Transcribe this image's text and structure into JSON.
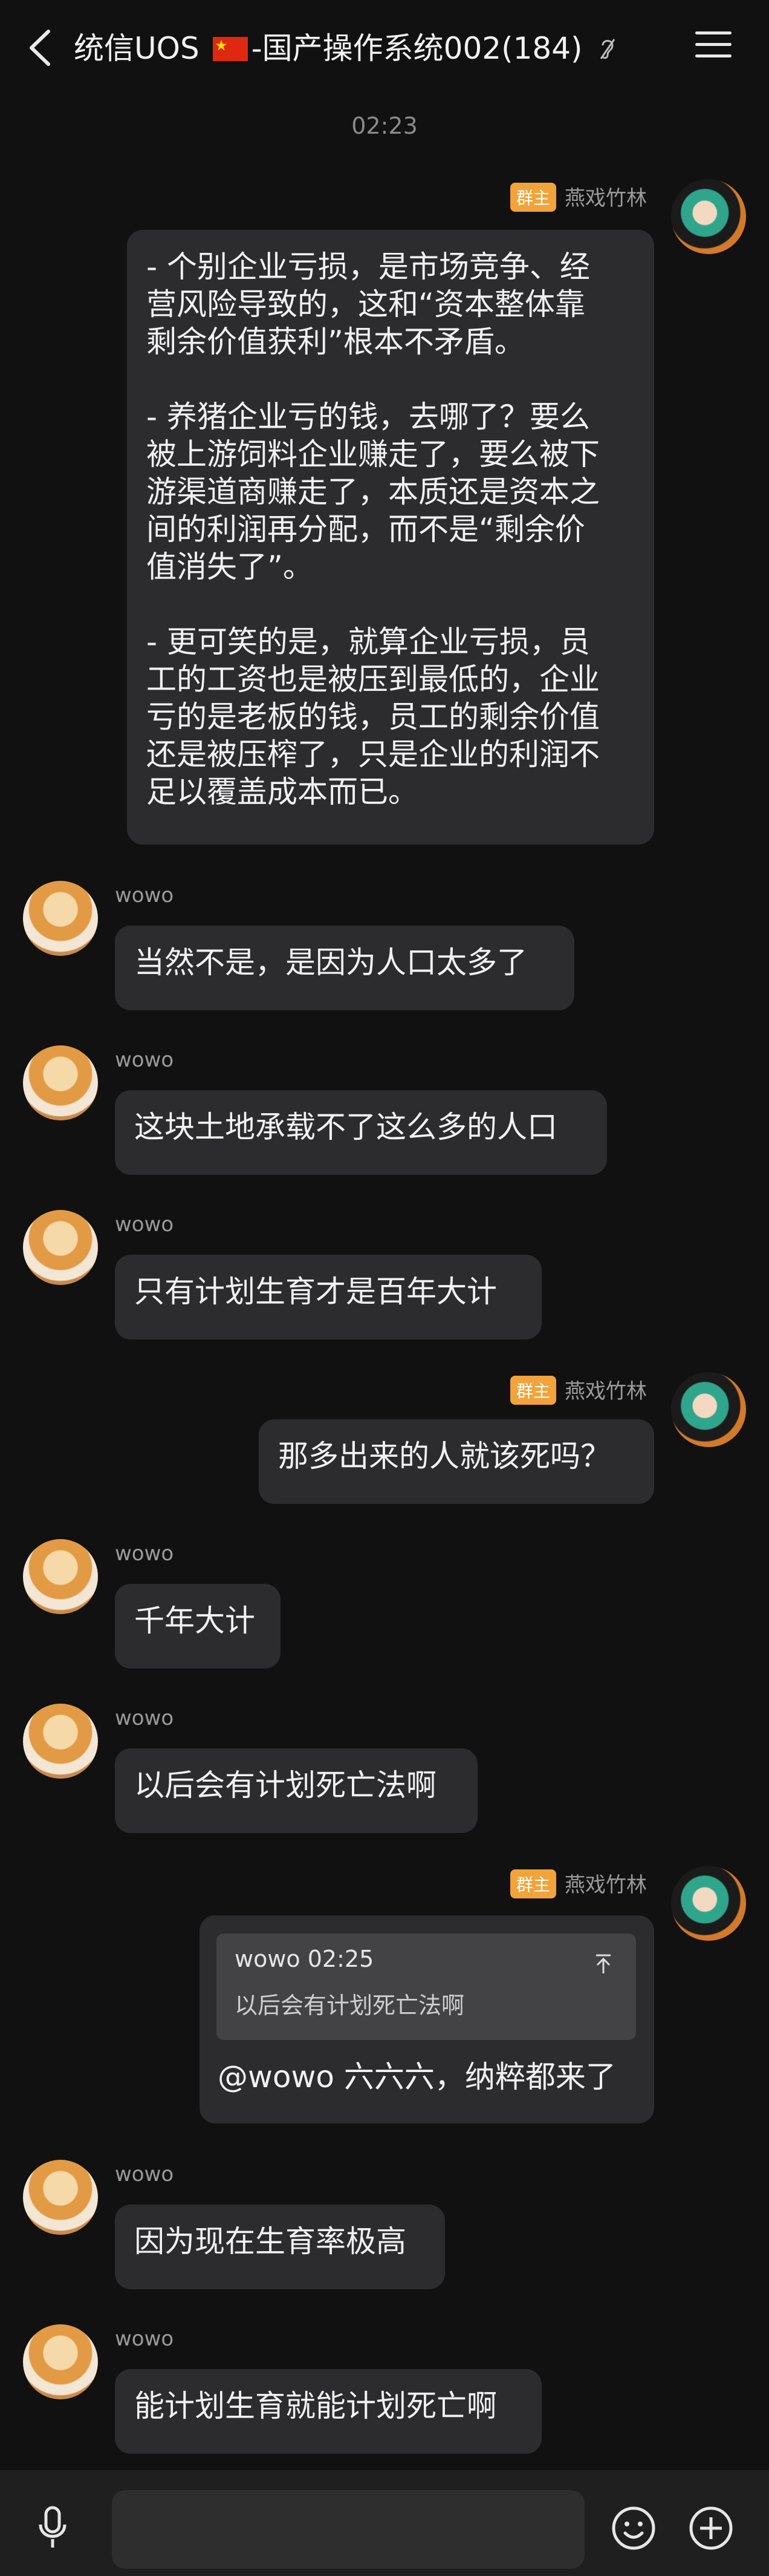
{
  "header": {
    "title_prefix": "统信UOS",
    "title_suffix": "-国产操作系统002(184)",
    "icons": {
      "back": "chevron-left-icon",
      "flag": "china-flag-icon",
      "muted": "ear-off-icon",
      "menu": "hamburger-menu-icon"
    }
  },
  "timestamp": "02:23",
  "owner_badge": "群主",
  "messages": [
    {
      "sender": "燕戏竹林",
      "owner": true,
      "side": "right",
      "avatar": "anime-avatar",
      "text": "- 个别企业亏损，是市场竞争、经\n营风险导致的，这和“资本整体靠\n剩余价值获利”根本不矛盾。\n\n- 养猪企业亏的钱，去哪了？要么\n被上游饲料企业赚走了，要么被下\n游渠道商赚走了，本质还是资本之\n间的利润再分配，而不是“剩余价\n值消失了”。\n\n- 更可笑的是，就算企业亏损，员\n工的工资也是被压到最低的，企业\n亏的是老板的钱，员工的剩余价值\n还是被压榨了，只是企业的利润不\n足以覆盖成本而已。"
    },
    {
      "sender": "wowo",
      "side": "left",
      "avatar": "cat-avatar",
      "text": "当然不是，是因为人口太多了"
    },
    {
      "sender": "wowo",
      "side": "left",
      "avatar": "cat-avatar",
      "text": "这块土地承载不了这么多的人口"
    },
    {
      "sender": "wowo",
      "side": "left",
      "avatar": "cat-avatar",
      "text": "只有计划生育才是百年大计"
    },
    {
      "sender": "燕戏竹林",
      "owner": true,
      "side": "right",
      "avatar": "anime-avatar",
      "text": "那多出来的人就该死吗？"
    },
    {
      "sender": "wowo",
      "side": "left",
      "avatar": "cat-avatar",
      "text": "千年大计"
    },
    {
      "sender": "wowo",
      "side": "left",
      "avatar": "cat-avatar",
      "text": "以后会有计划死亡法啊"
    },
    {
      "sender": "燕戏竹林",
      "owner": true,
      "side": "right",
      "avatar": "anime-avatar",
      "quote": {
        "author": "wowo",
        "time": "02:25",
        "text": "以后会有计划死亡法啊"
      },
      "text": "@wowo 六六六，纳粹都来了"
    },
    {
      "sender": "wowo",
      "side": "left",
      "avatar": "cat-avatar",
      "text": "因为现在生育率极高"
    },
    {
      "sender": "wowo",
      "side": "left",
      "avatar": "cat-avatar",
      "text": "能计划生育就能计划死亡啊"
    }
  ],
  "bottom_bar": {
    "input_value": "",
    "icons": [
      "microphone-icon",
      "emoji-icon",
      "plus-icon"
    ]
  }
}
